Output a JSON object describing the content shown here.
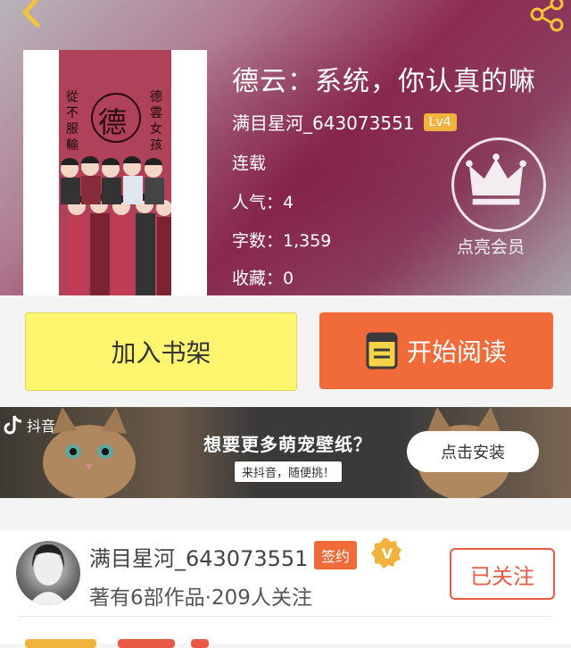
{
  "book": {
    "title": "德云：系统，你认真的嘛",
    "author": "满目星河_643073551",
    "level": "Lv4",
    "status": "连载",
    "popularity": "人气：4",
    "word_count": "字数：1,359",
    "favorites": "收藏：0"
  },
  "cover": {
    "left_text": "從不服輸",
    "right_text": "德雲女孩",
    "seal": "德"
  },
  "vip": {
    "label": "点亮会员"
  },
  "actions": {
    "add_shelf": "加入书架",
    "start_read": "开始阅读"
  },
  "ad": {
    "brand": "抖音",
    "headline": "想要更多萌宠壁纸？",
    "sub": "来抖音，随便挑！",
    "install": "点击安装"
  },
  "author_card": {
    "name": "满目星河_643073551",
    "sign_badge": "签约",
    "v_badge": "V",
    "stats": "著有6部作品·209人关注",
    "follow_label": "已关注"
  },
  "colors": {
    "accent_orange": "#f06a3a",
    "accent_yellow": "#fff56f",
    "level_badge": "#f2b23e"
  }
}
